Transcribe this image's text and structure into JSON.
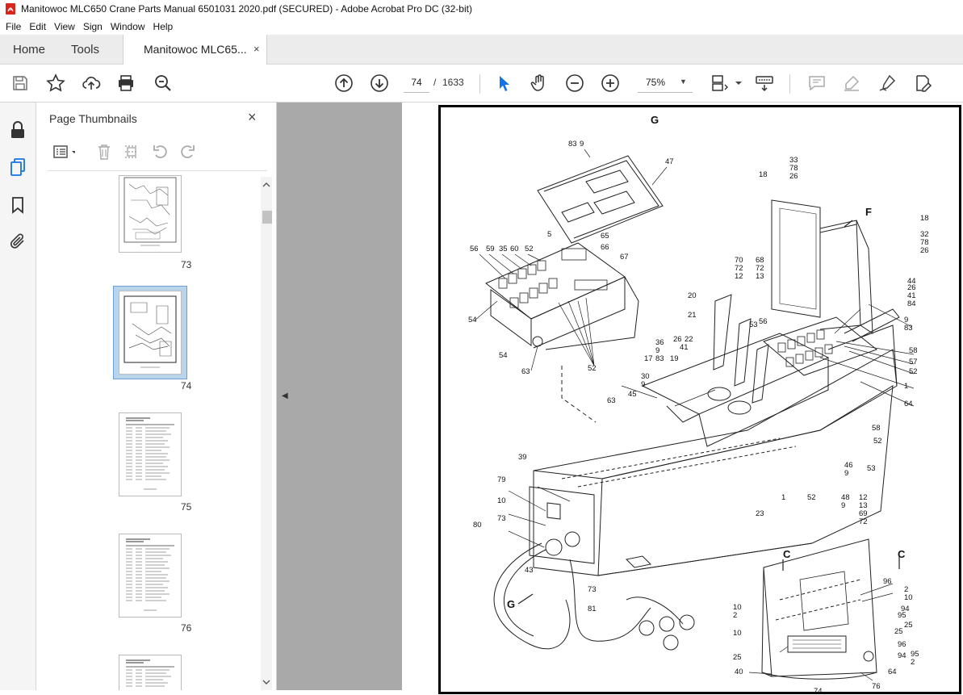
{
  "window": {
    "title": "Manitowoc MLC650 Crane Parts Manual 6501031 2020.pdf (SECURED) - Adobe Acrobat Pro DC (32-bit)"
  },
  "menu": [
    "File",
    "Edit",
    "View",
    "Sign",
    "Window",
    "Help"
  ],
  "tabs": {
    "home": "Home",
    "tools": "Tools",
    "document": "Manitowoc MLC65...",
    "close_glyph": "×"
  },
  "toolbar": {
    "current_page": "74",
    "page_separator": "/",
    "total_pages": "1633",
    "zoom": "75%"
  },
  "thumbnails": {
    "panel_title": "Page Thumbnails",
    "close_glyph": "×",
    "pages": [
      {
        "label": "73",
        "selected": false
      },
      {
        "label": "74",
        "selected": true
      },
      {
        "label": "75",
        "selected": false
      },
      {
        "label": "76",
        "selected": false
      }
    ]
  },
  "drawing": {
    "callouts": [
      "83",
      "9",
      "47",
      "5",
      "65",
      "66",
      "67",
      "56",
      "59",
      "35",
      "60",
      "52",
      "54",
      "54",
      "63",
      "52",
      "33",
      "78",
      "26",
      "18",
      "F",
      "18",
      "32",
      "78",
      "26",
      "44",
      "26",
      "41",
      "84",
      "9",
      "83",
      "70",
      "72",
      "12",
      "68",
      "72",
      "13",
      "20",
      "21",
      "53",
      "56",
      "58",
      "57",
      "52",
      "1",
      "64",
      "36",
      "9",
      "26",
      "22",
      "41",
      "17",
      "83",
      "19",
      "30",
      "9",
      "45",
      "63",
      "39",
      "79",
      "10",
      "73",
      "80",
      "43",
      "G",
      "73",
      "81",
      "23",
      "1",
      "52",
      "48",
      "9",
      "12",
      "13",
      "69",
      "72",
      "46",
      "9",
      "53",
      "52",
      "58",
      "C",
      "C",
      "96",
      "2",
      "10",
      "94",
      "25",
      "95",
      "25",
      "96",
      "94",
      "95",
      "2",
      "10",
      "2",
      "10",
      "25",
      "40",
      "76",
      "64",
      "74",
      "G"
    ]
  }
}
